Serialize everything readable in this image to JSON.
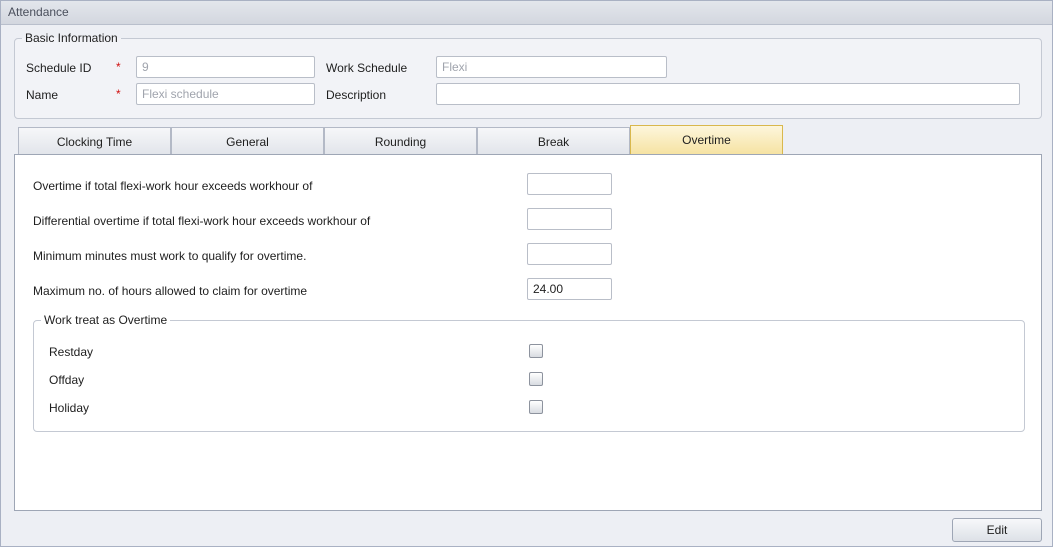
{
  "window": {
    "title": "Attendance"
  },
  "basic_info": {
    "legend": "Basic Information",
    "schedule_id": {
      "label": "Schedule ID",
      "required_mark": "*",
      "value": "9"
    },
    "work_schedule": {
      "label": "Work Schedule",
      "value": "Flexi"
    },
    "name": {
      "label": "Name",
      "required_mark": "*",
      "value": "Flexi schedule"
    },
    "description": {
      "label": "Description",
      "value": ""
    }
  },
  "tabs": [
    {
      "label": "Clocking Time",
      "active": false
    },
    {
      "label": "General",
      "active": false
    },
    {
      "label": "Rounding",
      "active": false
    },
    {
      "label": "Break",
      "active": false
    },
    {
      "label": "Overtime",
      "active": true
    }
  ],
  "overtime": {
    "fields": [
      {
        "label": "Overtime if total flexi-work hour exceeds workhour of",
        "value": ""
      },
      {
        "label": "Differential overtime if total flexi-work hour exceeds workhour of",
        "value": ""
      },
      {
        "label": "Minimum minutes must work to qualify for overtime.",
        "value": ""
      },
      {
        "label": "Maximum no. of hours allowed to claim for overtime",
        "value": "24.00"
      }
    ],
    "work_treat": {
      "legend": "Work treat as Overtime",
      "items": [
        {
          "label": "Restday",
          "checked": false
        },
        {
          "label": "Offday",
          "checked": false
        },
        {
          "label": "Holiday",
          "checked": false
        }
      ]
    }
  },
  "footer": {
    "edit_label": "Edit"
  },
  "colors": {
    "active_tab": "#f6e3a4",
    "required": "#d01010",
    "panel_border": "#9ea6b5"
  }
}
